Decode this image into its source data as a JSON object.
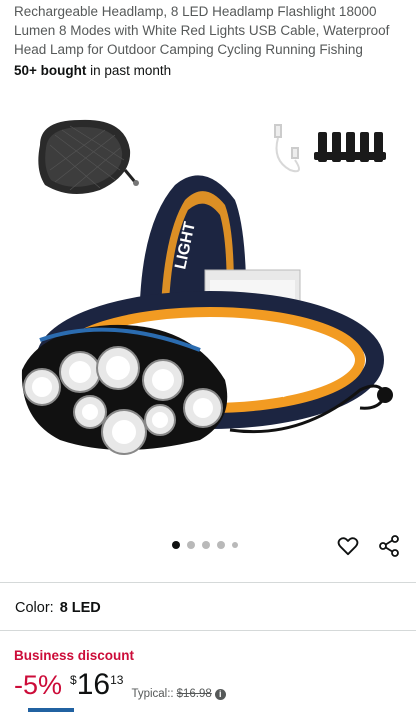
{
  "product": {
    "title": "Rechargeable Headlamp, 8 LED Headlamp Flashlight 18000 Lumen 8 Modes with White Red Lights USB Cable, Waterproof Head Lamp for Outdoor Camping Cycling Running Fishing",
    "bought_count": "50+ bought",
    "bought_suffix": " in past month"
  },
  "carousel": {
    "total_dots": 5,
    "active_index": 0
  },
  "actions": {
    "favorite_icon": "heart-outline-icon",
    "share_icon": "share-icon"
  },
  "variant": {
    "label": "Color:",
    "value": "8 LED"
  },
  "pricing": {
    "business_label": "Business discount",
    "discount": "-5%",
    "currency": "$",
    "whole": "16",
    "fraction": "13",
    "typical_label": "Typical::",
    "typical_price": "$16.98",
    "info_icon": "info-icon"
  },
  "colors": {
    "accent_red": "#cc0c39",
    "text": "#0f1111",
    "muted": "#565959",
    "link_blue": "#2162a1"
  }
}
